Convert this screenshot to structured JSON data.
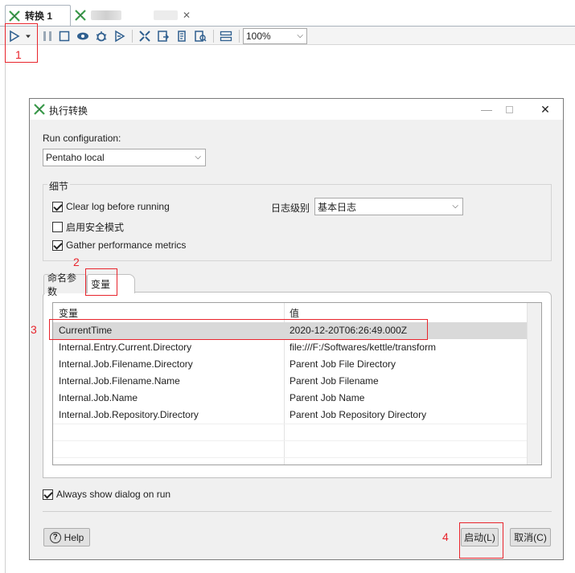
{
  "tabs": [
    {
      "label": "转换 1",
      "active": true
    },
    {
      "label": "",
      "blurred": true,
      "active": false
    }
  ],
  "toolbar": {
    "zoom": "100%",
    "icons": [
      "run-icon",
      "run-dropdown-icon",
      "pause-icon",
      "stop-icon",
      "preview-icon",
      "debug-icon",
      "replay-icon",
      "verify-icon",
      "impact-icon",
      "sql-icon",
      "explore-db-icon",
      "results-icon"
    ]
  },
  "dialog": {
    "title": "执行转换",
    "run_config_label": "Run configuration:",
    "run_config_value": "Pentaho local",
    "details_title": "细节",
    "clear_log": {
      "label": "Clear log before running",
      "checked": true
    },
    "safe_mode": {
      "label": "启用安全模式",
      "checked": false
    },
    "gather_metrics": {
      "label": "Gather performance metrics",
      "checked": true
    },
    "log_level_label": "日志级别",
    "log_level_value": "基本日志",
    "param_tabs": [
      "命名参数",
      "变量"
    ],
    "grid": {
      "headers": [
        "变量",
        "值"
      ],
      "rows": [
        {
          "name": "CurrentTime",
          "value": "2020-12-20T06:26:49.000Z",
          "selected": true
        },
        {
          "name": "Internal.Entry.Current.Directory",
          "value": "file:///F:/Softwares/kettle/transform"
        },
        {
          "name": "Internal.Job.Filename.Directory",
          "value": "Parent Job File Directory"
        },
        {
          "name": "Internal.Job.Filename.Name",
          "value": "Parent Job Filename"
        },
        {
          "name": "Internal.Job.Name",
          "value": "Parent Job Name"
        },
        {
          "name": "Internal.Job.Repository.Directory",
          "value": "Parent Job Repository Directory"
        }
      ]
    },
    "always_show": {
      "label": "Always show dialog on run",
      "checked": true
    },
    "help_label": "Help",
    "launch_label": "启动(L)",
    "cancel_label": "取消(C)"
  },
  "annotations": [
    "1",
    "2",
    "3",
    "4"
  ],
  "colors": {
    "annotation": "#e8242c",
    "selected_row": "#d9d9d9",
    "toolbar_icon": "#2f5f8f",
    "kettle_green": "#3a9b4b"
  }
}
